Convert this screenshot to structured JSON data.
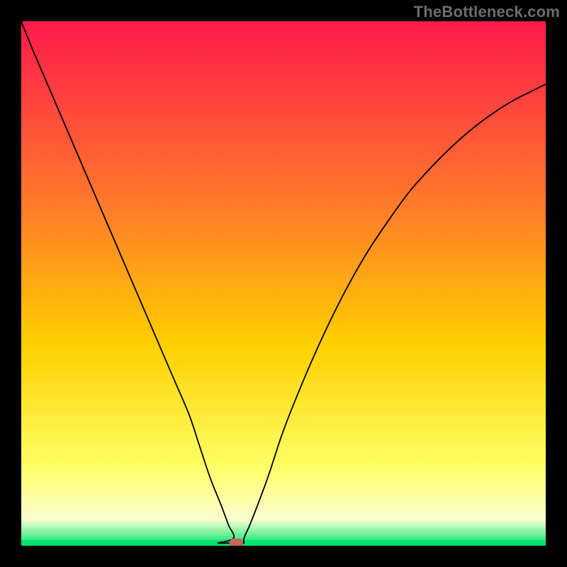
{
  "attribution": "TheBottleneck.com",
  "colors": {
    "background": "#000000",
    "gradient_top": "#ff1a4c",
    "gradient_mid_upper": "#ff7a2a",
    "gradient_mid": "#ffd000",
    "gradient_lower": "#ffff66",
    "gradient_baseband": "#faffd0",
    "gradient_green": "#00e56a",
    "curve_stroke": "#000000",
    "marker_fill": "#c1675c"
  },
  "chart_data": {
    "type": "line",
    "title": "",
    "xlabel": "",
    "ylabel": "",
    "xlim": [
      0,
      100
    ],
    "ylim": [
      0,
      100
    ],
    "grid": false,
    "legend": "none",
    "series": [
      {
        "name": "bottleneck-curve",
        "x": [
          0,
          2,
          5,
          8,
          11,
          14,
          17,
          20,
          23,
          26,
          29,
          32,
          34,
          36,
          38,
          39.5,
          40.5,
          41.5,
          42.5,
          44,
          47,
          50,
          54,
          58,
          62,
          66,
          70,
          74,
          78,
          82,
          86,
          90,
          94,
          98,
          100
        ],
        "values": [
          100,
          95,
          88,
          81,
          74,
          67,
          60,
          53,
          46,
          39,
          32,
          25,
          19,
          13,
          8,
          4,
          1.5,
          0.5,
          1.5,
          5,
          13,
          22,
          32,
          41,
          49,
          56,
          62,
          67.5,
          72,
          76,
          79.5,
          82.5,
          85,
          87,
          88
        ]
      }
    ],
    "flat_segment": {
      "x_start": 37.5,
      "x_end": 42.5,
      "y": 0.5
    },
    "marker": {
      "x": 41,
      "y": 0.5,
      "shape": "rounded-rect"
    },
    "annotations": []
  }
}
